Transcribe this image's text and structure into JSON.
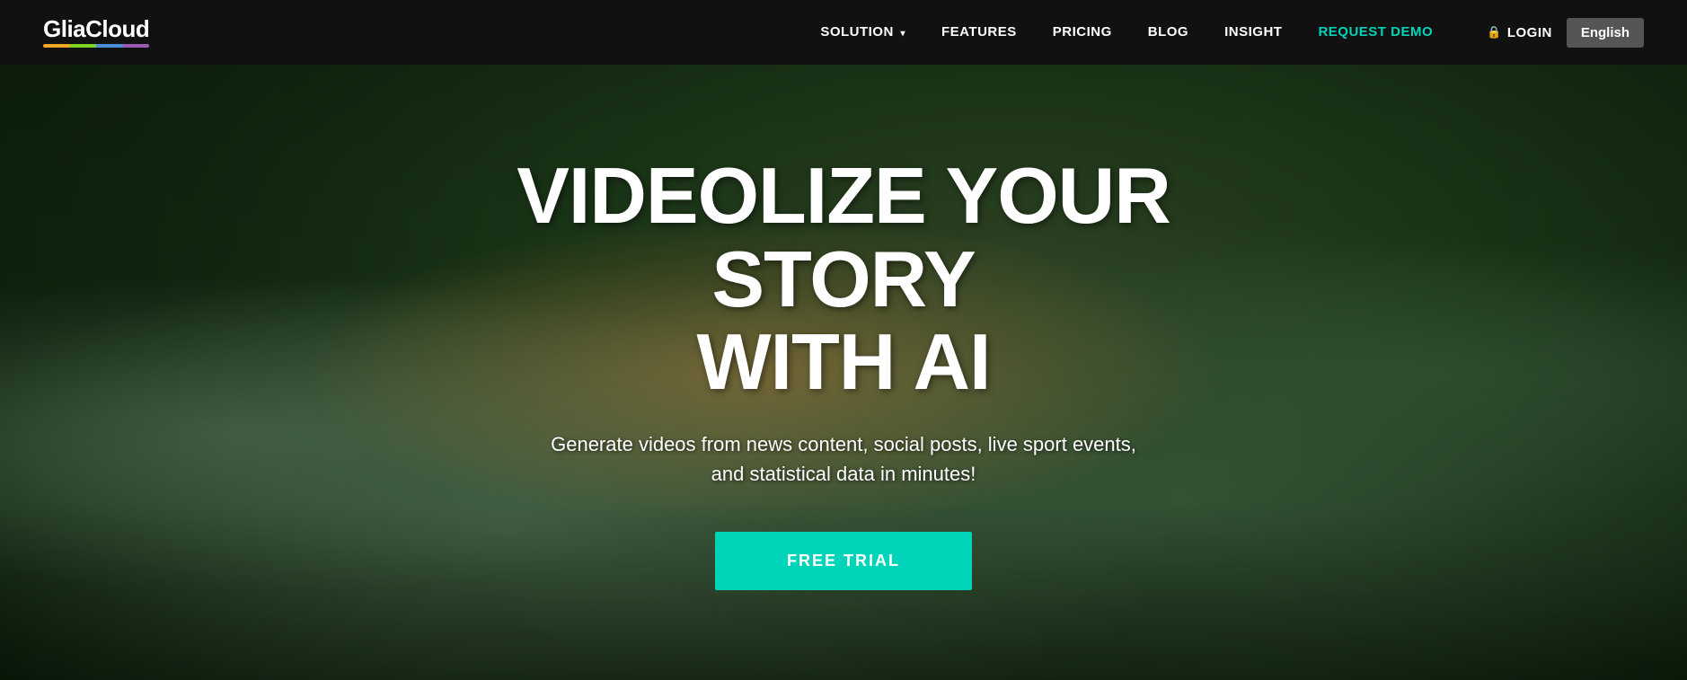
{
  "nav": {
    "logo_text": "GliaCloud",
    "logo_colors": [
      "#f5a623",
      "#7ed321",
      "#4a90d9",
      "#9b59b6"
    ],
    "links": [
      {
        "id": "solution",
        "label": "SOLUTION",
        "has_dropdown": true,
        "active": false
      },
      {
        "id": "features",
        "label": "FEATURES",
        "has_dropdown": false,
        "active": false
      },
      {
        "id": "pricing",
        "label": "PRICING",
        "has_dropdown": false,
        "active": false
      },
      {
        "id": "blog",
        "label": "BLOG",
        "has_dropdown": false,
        "active": false
      },
      {
        "id": "insight",
        "label": "INSIGHT",
        "has_dropdown": false,
        "active": false
      },
      {
        "id": "request-demo",
        "label": "REQUEST DEMO",
        "has_dropdown": false,
        "active": true
      }
    ],
    "login_label": "LOGIN",
    "lang_label": "English"
  },
  "hero": {
    "title_line1": "VIDEOLIZE YOUR STORY",
    "title_line2": "WITH AI",
    "subtitle": "Generate videos from news content, social posts, live sport events,\nand statistical data in minutes!",
    "cta_label": "FREE TRIAL"
  }
}
